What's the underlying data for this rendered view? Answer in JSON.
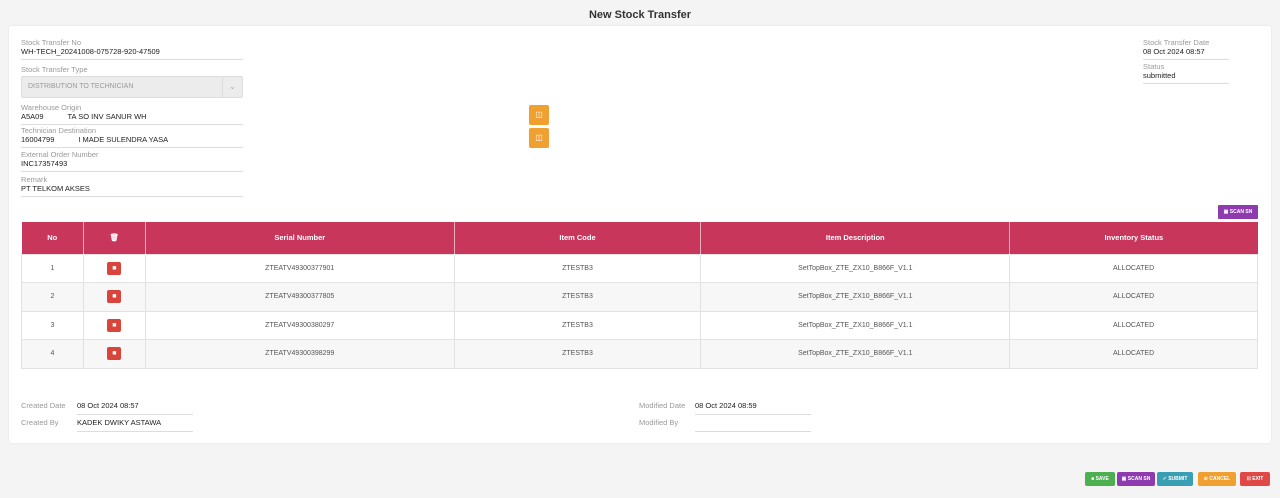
{
  "page": {
    "title": "New Stock Transfer"
  },
  "form": {
    "transfer_no": {
      "label": "Stock Transfer No",
      "value": "WH-TECH_20241008-075728-920-47509"
    },
    "transfer_type": {
      "label": "Stock Transfer Type",
      "value": "DISTRIBUTION TO TECHNICIAN"
    },
    "warehouse_origin": {
      "label": "Warehouse Origin",
      "code": "A5A09",
      "name": "TA SO INV SANUR WH"
    },
    "technician_destination": {
      "label": "Technician Destination",
      "code": "16004799",
      "name": "I MADE SULENDRA YASA"
    },
    "external_order": {
      "label": "External Order Number",
      "value": "INC17357493"
    },
    "remark": {
      "label": "Remark",
      "value": "PT TELKOM AKSES"
    },
    "transfer_date": {
      "label": "Stock Transfer Date",
      "value": "08 Oct 2024 08:57"
    },
    "status": {
      "label": "Status",
      "value": "submitted"
    }
  },
  "table": {
    "scan_label": "SCAN SN",
    "headers": {
      "no": "No",
      "serial": "Serial Number",
      "item_code": "Item Code",
      "description": "Item Description",
      "status": "Inventory Status"
    },
    "rows": [
      {
        "no": "1",
        "serial": "ZTEATV49300377901",
        "item_code": "ZTESTB3",
        "description": "SetTopBox_ZTE_ZX10_B866F_V1.1",
        "status": "ALLOCATED"
      },
      {
        "no": "2",
        "serial": "ZTEATV49300377805",
        "item_code": "ZTESTB3",
        "description": "SetTopBox_ZTE_ZX10_B866F_V1.1",
        "status": "ALLOCATED"
      },
      {
        "no": "3",
        "serial": "ZTEATV49300380297",
        "item_code": "ZTESTB3",
        "description": "SetTopBox_ZTE_ZX10_B866F_V1.1",
        "status": "ALLOCATED"
      },
      {
        "no": "4",
        "serial": "ZTEATV49300398299",
        "item_code": "ZTESTB3",
        "description": "SetTopBox_ZTE_ZX10_B866F_V1.1",
        "status": "ALLOCATED"
      }
    ]
  },
  "meta": {
    "created_date_label": "Created Date",
    "created_date": "08 Oct 2024 08:57",
    "created_by_label": "Created By",
    "created_by": "KADEK DWIKY ASTAWA",
    "modified_date_label": "Modified Date",
    "modified_date": "08 Oct 2024 08:59",
    "modified_by_label": "Modified By",
    "modified_by": ""
  },
  "footer": {
    "save": "SAVE",
    "scan": "SCAN SN",
    "submit": "SUBMIT",
    "cancel": "CANCEL",
    "exit": "EXIT"
  },
  "colors": {
    "header": "#c8365c",
    "save": "#4caf50",
    "scan": "#8e3bb0",
    "submit": "#3a9fb5",
    "cancel": "#f0a030",
    "exit": "#e04848",
    "lookup": "#f0a030",
    "delete": "#d9443b"
  }
}
